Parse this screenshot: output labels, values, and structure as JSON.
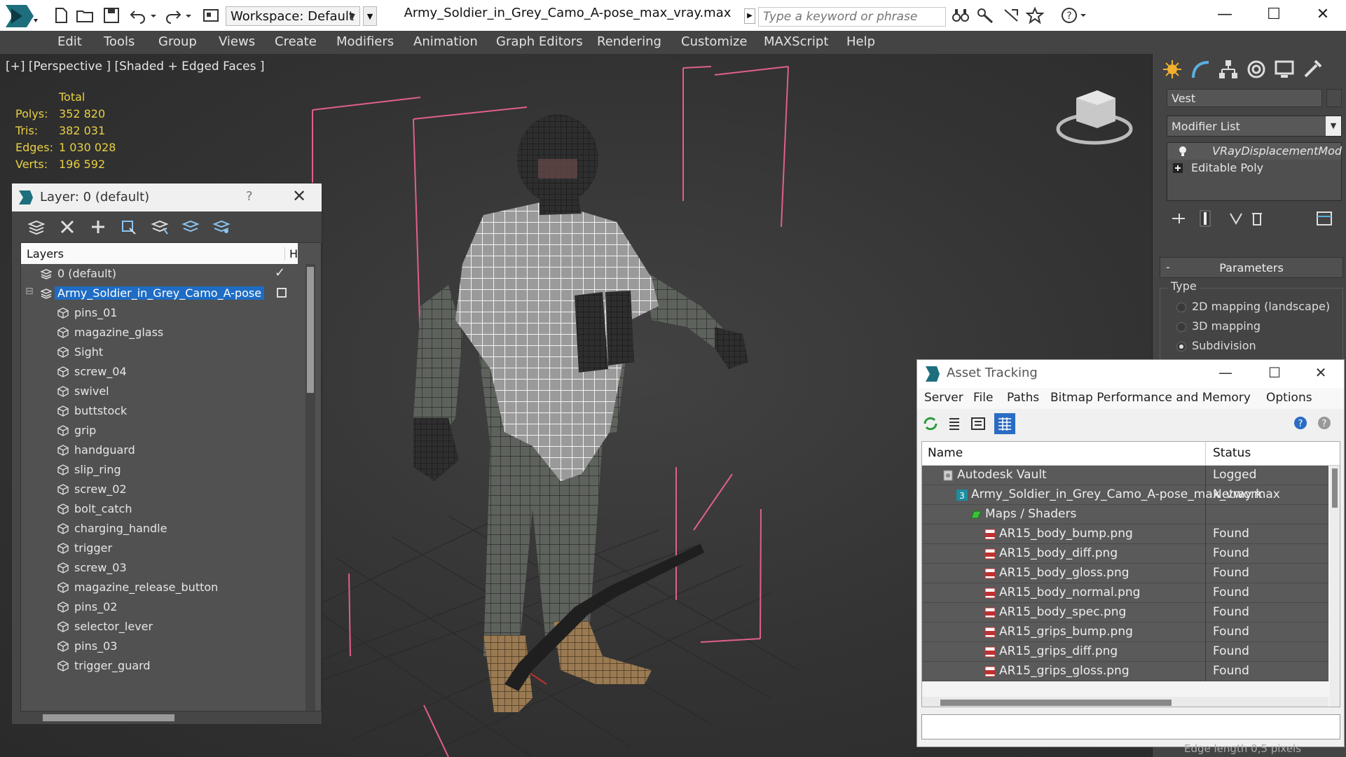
{
  "title_bar": {
    "workspace_label": "Workspace: Default",
    "window_title": "Army_Soldier_in_Grey_Camo_A-pose_max_vray.max",
    "search_placeholder": "Type a keyword or phrase",
    "minimize": "—",
    "maximize": "☐",
    "close": "✕"
  },
  "menu": [
    "Edit",
    "Tools",
    "Group",
    "Views",
    "Create",
    "Modifiers",
    "Animation",
    "Graph Editors",
    "Rendering",
    "Customize",
    "MAXScript",
    "Help"
  ],
  "viewport": {
    "label": "[+] [Perspective ] [Shaded + Edged Faces ]",
    "stats": {
      "header": "Total",
      "rows": [
        {
          "key": "Polys:",
          "value": "352 820"
        },
        {
          "key": "Tris:",
          "value": "382 031"
        },
        {
          "key": "Edges:",
          "value": "1 030 028"
        },
        {
          "key": "Verts:",
          "value": "196 592"
        }
      ]
    }
  },
  "layer_dialog": {
    "title": "Layer: 0 (default)",
    "help": "?",
    "close": "✕",
    "list_header": "Layers",
    "list_header_col2": "H",
    "default_layer": "0 (default)",
    "active_layer": "Army_Soldier_in_Grey_Camo_A-pose",
    "objects": [
      "pins_01",
      "magazine_glass",
      "Sight",
      "screw_04",
      "swivel",
      "buttstock",
      "grip",
      "handguard",
      "slip_ring",
      "screw_02",
      "bolt_catch",
      "charging_handle",
      "trigger",
      "screw_03",
      "magazine_release_button",
      "pins_02",
      "selector_lever",
      "pins_03",
      "trigger_guard"
    ]
  },
  "command_panel": {
    "object_name": "Vest",
    "modifier_list": "Modifier List",
    "stack": [
      "VRayDisplacementMod",
      "Editable Poly"
    ],
    "parameters_rollout": "Parameters",
    "type_label": "Type",
    "radios": [
      {
        "label": "2D mapping (landscape)",
        "on": false
      },
      {
        "label": "3D mapping",
        "on": false
      },
      {
        "label": "Subdivision",
        "on": true
      }
    ]
  },
  "asset_tracking": {
    "title": "Asset Tracking",
    "menu": [
      "Server",
      "File",
      "Paths",
      "Bitmap Performance and Memory",
      "Options"
    ],
    "columns": {
      "name": "Name",
      "status": "Status"
    },
    "rows": [
      {
        "name": "Autodesk Vault",
        "status": "Logged",
        "indent": 0,
        "icon": "vault-icon"
      },
      {
        "name": "Army_Soldier_in_Grey_Camo_A-pose_max_vray.max",
        "status": "Network",
        "indent": 1,
        "icon": "max-file-icon"
      },
      {
        "name": "Maps / Shaders",
        "status": "",
        "indent": 2,
        "icon": "maps-folder-icon"
      },
      {
        "name": "AR15_body_bump.png",
        "status": "Found",
        "indent": 3,
        "icon": "png-icon"
      },
      {
        "name": "AR15_body_diff.png",
        "status": "Found",
        "indent": 3,
        "icon": "png-icon"
      },
      {
        "name": "AR15_body_gloss.png",
        "status": "Found",
        "indent": 3,
        "icon": "png-icon"
      },
      {
        "name": "AR15_body_normal.png",
        "status": "Found",
        "indent": 3,
        "icon": "png-icon"
      },
      {
        "name": "AR15_body_spec.png",
        "status": "Found",
        "indent": 3,
        "icon": "png-icon"
      },
      {
        "name": "AR15_grips_bump.png",
        "status": "Found",
        "indent": 3,
        "icon": "png-icon"
      },
      {
        "name": "AR15_grips_diff.png",
        "status": "Found",
        "indent": 3,
        "icon": "png-icon"
      },
      {
        "name": "AR15_grips_gloss.png",
        "status": "Found",
        "indent": 3,
        "icon": "png-icon"
      }
    ]
  },
  "status_bar": {
    "edge_length": "Edge length  0,5      pixels"
  },
  "colors": {
    "selection": "#1e6cc4",
    "stats_text": "#e8d044",
    "bounding_box": "#e0608a"
  }
}
